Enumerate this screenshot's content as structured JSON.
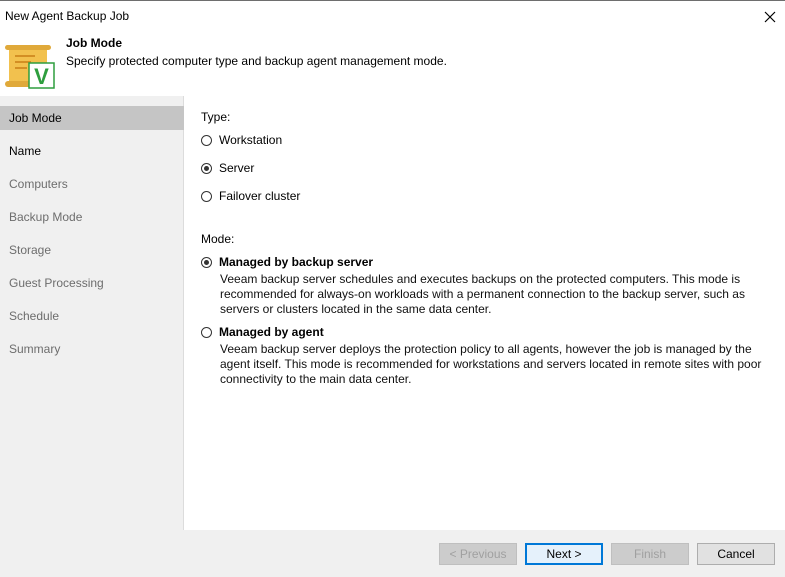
{
  "window": {
    "title": "New Agent Backup Job"
  },
  "header": {
    "title": "Job Mode",
    "subtitle": "Specify protected computer type and backup agent management mode.",
    "logo_letter": "V"
  },
  "sidebar": {
    "items": [
      {
        "label": "Job Mode"
      },
      {
        "label": "Name"
      },
      {
        "label": "Computers"
      },
      {
        "label": "Backup Mode"
      },
      {
        "label": "Storage"
      },
      {
        "label": "Guest Processing"
      },
      {
        "label": "Schedule"
      },
      {
        "label": "Summary"
      }
    ]
  },
  "main": {
    "type_label": "Type:",
    "type_options": [
      {
        "label": "Workstation",
        "checked": false
      },
      {
        "label": "Server",
        "checked": true
      },
      {
        "label": "Failover cluster",
        "checked": false
      }
    ],
    "mode_label": "Mode:",
    "mode_options": [
      {
        "label": "Managed by backup server",
        "checked": true,
        "description": "Veeam backup server schedules and executes backups on the protected computers. This mode is recommended for always-on workloads with a permanent connection to the backup server, such as servers or clusters located in the same data center."
      },
      {
        "label": "Managed by agent",
        "checked": false,
        "description": "Veeam backup server deploys the protection policy to all agents, however the job is managed by the agent itself. This mode is recommended for workstations and servers located in remote sites with poor connectivity to the main data center."
      }
    ]
  },
  "footer": {
    "previous_label": "< Previous",
    "next_label": "Next >",
    "finish_label": "Finish",
    "cancel_label": "Cancel"
  },
  "colors": {
    "accent": "#0078d7",
    "logo_scroll": "#f2c14e",
    "logo_check": "#2e9e3e"
  }
}
